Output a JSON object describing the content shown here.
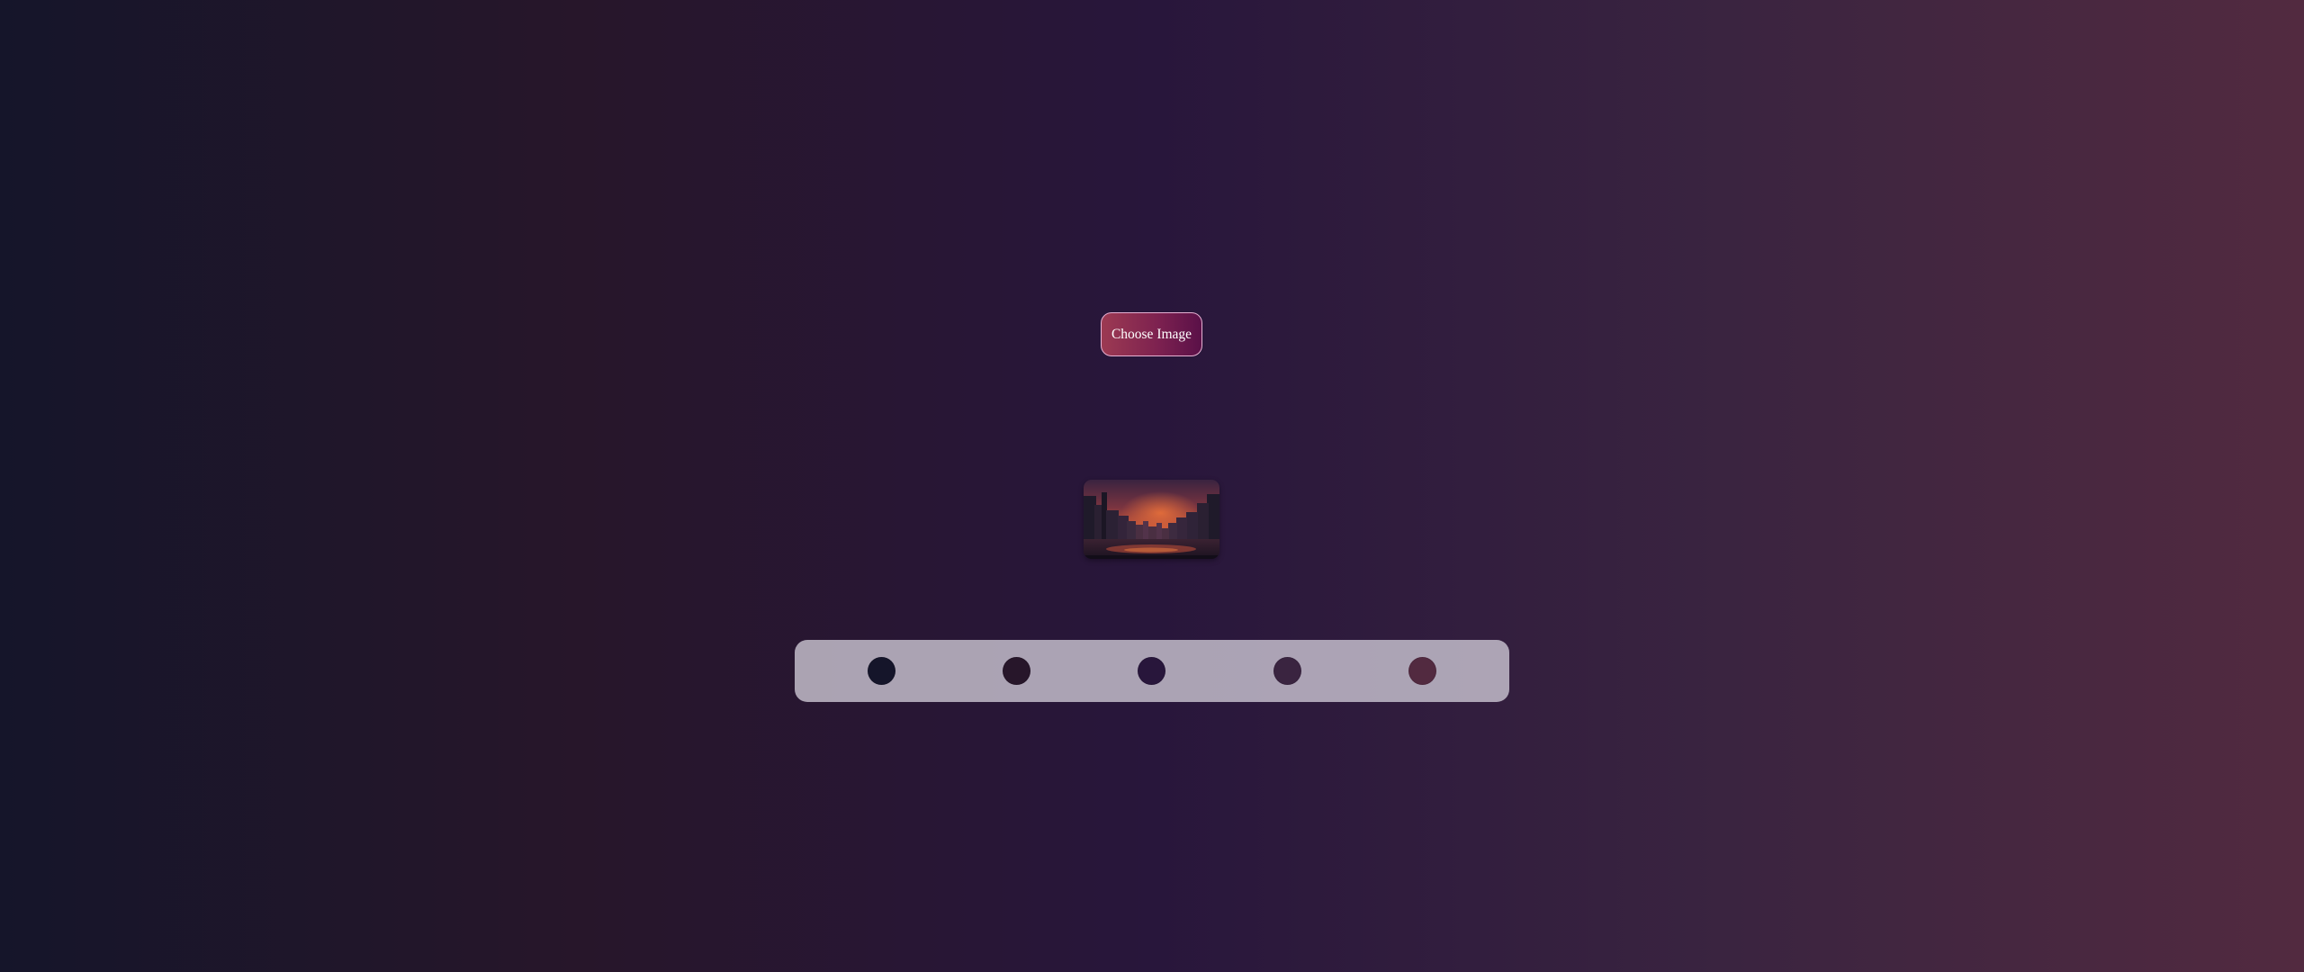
{
  "upload": {
    "button_label": "Choose Image"
  },
  "preview": {
    "image_name": "city-sunset-preview-image"
  },
  "palette": {
    "colors": [
      "#15152a",
      "#27162a",
      "#28163b",
      "#3a2440",
      "#522a40"
    ]
  },
  "theme": {
    "background_gradient": [
      "#15152a",
      "#27162a",
      "#28163b",
      "#3a2440",
      "#522a40"
    ],
    "button_gradient": [
      "#9c3a52",
      "#5a1048"
    ],
    "button_border": "#e7b1d3",
    "palette_bar_color": "#c8c2cf"
  }
}
